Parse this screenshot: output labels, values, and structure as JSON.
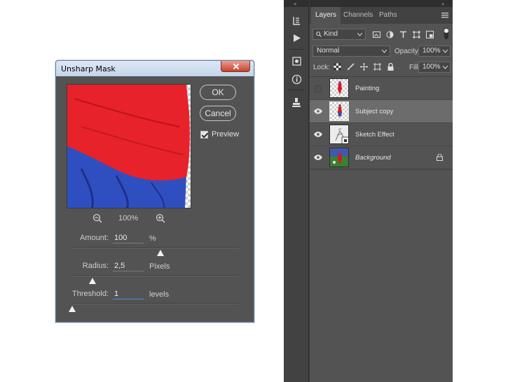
{
  "dialog": {
    "title": "Unsharp Mask",
    "ok_label": "OK",
    "cancel_label": "Cancel",
    "preview_label": "Preview",
    "preview_checked": true,
    "zoom": "100%",
    "amount": {
      "label": "Amount:",
      "value": "100",
      "unit": "%",
      "slider_fraction": 0.53
    },
    "radius": {
      "label": "Radius:",
      "value": "2,5",
      "unit": "Pixels",
      "slider_fraction": 0.12
    },
    "threshold": {
      "label": "Threshold:",
      "value": "1",
      "unit": "levels",
      "slider_fraction": 0.0
    }
  },
  "layers_panel": {
    "tabs": [
      "Layers",
      "Channels",
      "Paths"
    ],
    "active_tab": "Layers",
    "filter_kind": "Kind",
    "blend_mode": "Normal",
    "opacity_label": "Opacity:",
    "opacity_value": "100%",
    "lock_label": "Lock:",
    "fill_label": "Fill:",
    "fill_value": "100%",
    "layers": [
      {
        "name": "Painting",
        "visible": false,
        "selected": false,
        "italic": false,
        "locked": false
      },
      {
        "name": "Subject copy",
        "visible": true,
        "selected": true,
        "italic": false,
        "locked": false
      },
      {
        "name": "Sketch Effect",
        "visible": true,
        "selected": false,
        "italic": false,
        "locked": false
      },
      {
        "name": "Background",
        "visible": true,
        "selected": false,
        "italic": true,
        "locked": true
      }
    ]
  },
  "colors": {
    "panel_bg": "#535353",
    "selected_row": "#6c6c6c",
    "preview_red": "#e8222a",
    "preview_blue": "#2f4fc0"
  }
}
